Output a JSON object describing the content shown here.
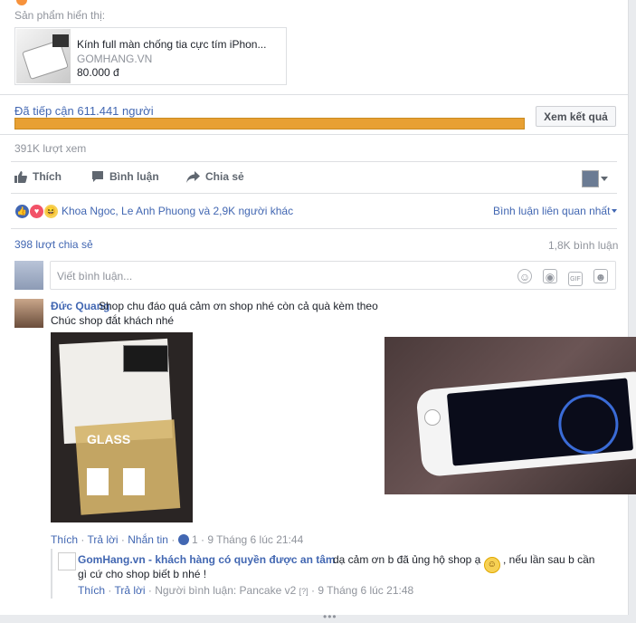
{
  "product": {
    "section_label": "Sản phẩm hiển thị:",
    "name": "Kính full màn chống tia cực tím iPhon...",
    "site": "GOMHANG.VN",
    "price": "80.000 đ"
  },
  "reach": {
    "text": "Đã tiếp cận 611.441 người",
    "progress": 1.0,
    "button_label": "Xem kết quả"
  },
  "views": "391K lượt xem",
  "actions": {
    "like": "Thích",
    "comment": "Bình luận",
    "share": "Chia sẻ"
  },
  "reactions": {
    "names": "Khoa Ngoc, Le Anh Phuong và 2,9K người khác",
    "sort_label": "Bình luận liên quan nhất"
  },
  "stats": {
    "shares": "398 lượt chia sẻ",
    "comments": "1,8K bình luận"
  },
  "comment_input": {
    "placeholder": "Viết bình luận..."
  },
  "comment": {
    "author": "Đức Quang",
    "text_line1": "Shop chu đáo quá cảm ơn shop nhé còn cả quà kèm theo",
    "text_line2": "Chúc shop đắt khách nhé",
    "photo1_text": "GLASS",
    "meta": {
      "like": "Thích",
      "reply": "Trả lời",
      "message": "Nhắn tin",
      "like_count": "1",
      "time": "9 Tháng 6 lúc 21:44"
    }
  },
  "reply": {
    "author": "GomHang.vn - khách hàng có quyền được an tâm",
    "text_part1": "dạ cảm ơn b đã ủng hộ shop ạ",
    "text_part2": ", nếu lần sau b cần",
    "text_line2": "gì cứ cho shop biết b nhé !",
    "meta": {
      "like": "Thích",
      "reply": "Trả lời",
      "commenter": "Người bình luận: Pancake v2",
      "commenter_tag": "[?]",
      "time": "9 Tháng 6 lúc 21:48"
    }
  },
  "colors": {
    "link": "#4267b2",
    "progress": "#e8a033",
    "muted": "#90949c"
  }
}
